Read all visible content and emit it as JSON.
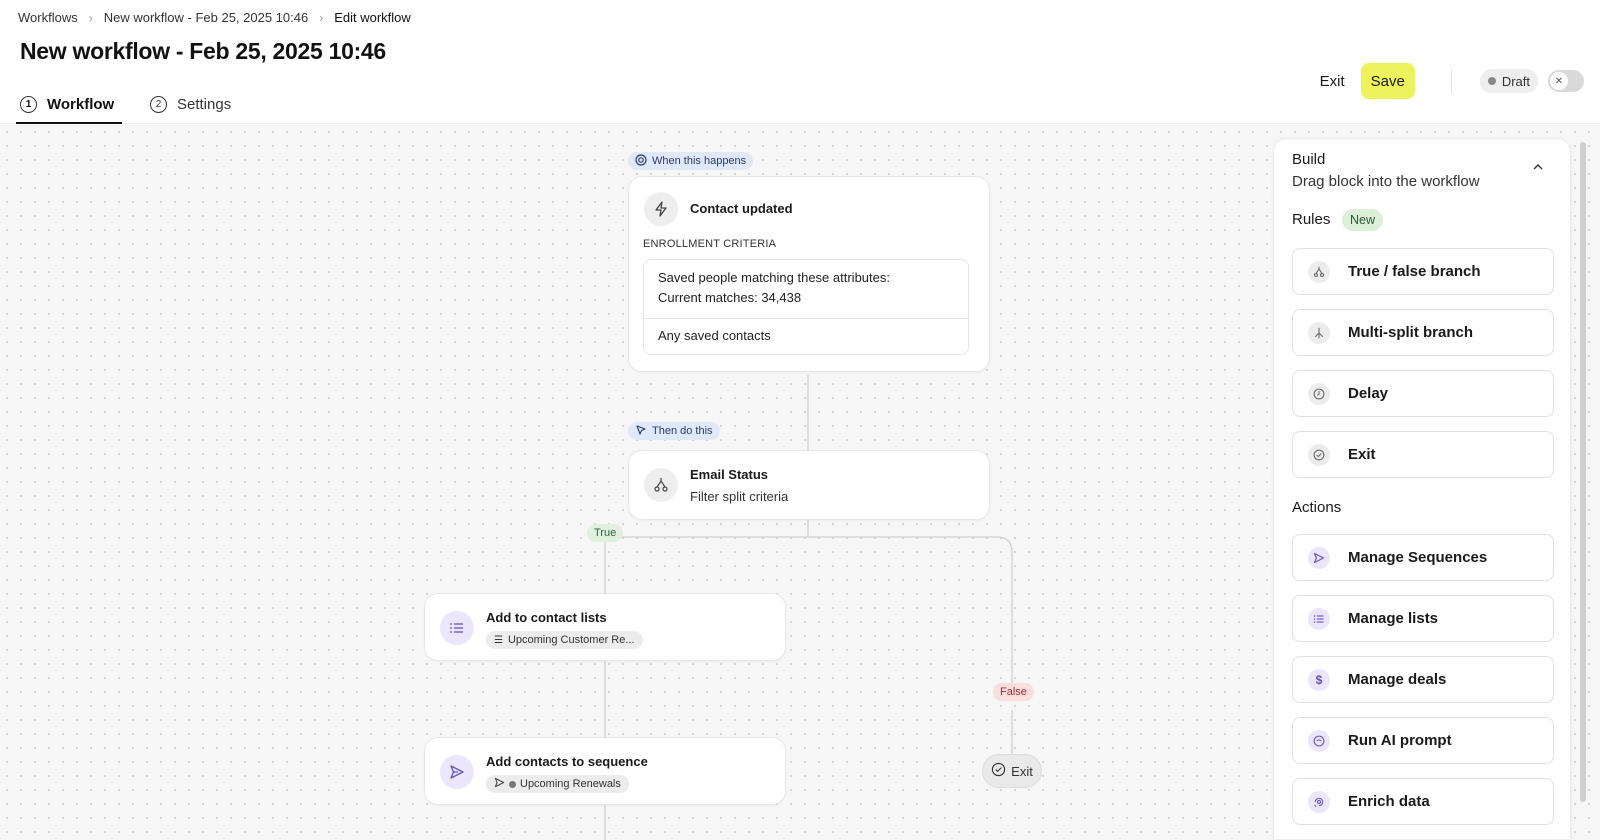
{
  "breadcrumb": {
    "root": "Workflows",
    "workflow": "New workflow - Feb 25, 2025 10:46",
    "current": "Edit workflow"
  },
  "page_title": "New workflow - Feb 25, 2025 10:46",
  "tabs": [
    {
      "num": "1",
      "label": "Workflow",
      "active": true
    },
    {
      "num": "2",
      "label": "Settings",
      "active": false
    }
  ],
  "actions": {
    "exit": "Exit",
    "save": "Save",
    "status": "Draft"
  },
  "colors": {
    "save_accent": "#ecf35c",
    "true_badge": "#dff0de",
    "false_badge": "#fadede",
    "trigger_badge": "#dfe9fb",
    "action_icon": "#ebe6fb"
  },
  "canvas": {
    "trigger_label": "When this happens",
    "trigger": {
      "title": "Contact updated",
      "criteria_label": "ENROLLMENT CRITERIA",
      "criteria_line1": "Saved people matching these attributes:",
      "criteria_line2": "Current matches: 34,438",
      "criteria_line3": "Any saved contacts"
    },
    "then_label": "Then do this",
    "split": {
      "title": "Email Status",
      "subtitle": "Filter split criteria"
    },
    "true_label": "True",
    "false_label": "False",
    "list_action": {
      "title": "Add to contact lists",
      "chip": "Upcoming Customer Re..."
    },
    "sequence_action": {
      "title": "Add contacts to sequence",
      "chip": "Upcoming Renewals"
    },
    "exit_node": "Exit"
  },
  "sidebar": {
    "title": "Build",
    "subtitle": "Drag block into the workflow",
    "rules_heading": "Rules",
    "new_badge": "New",
    "rules": [
      {
        "label": "True / false branch",
        "icon": "branch-icon"
      },
      {
        "label": "Multi-split branch",
        "icon": "multi-split-icon"
      },
      {
        "label": "Delay",
        "icon": "clock-icon"
      },
      {
        "label": "Exit",
        "icon": "check-circle-icon"
      }
    ],
    "actions_heading": "Actions",
    "actions": [
      {
        "label": "Manage Sequences",
        "icon": "send-icon"
      },
      {
        "label": "Manage lists",
        "icon": "list-icon"
      },
      {
        "label": "Manage deals",
        "icon": "dollar-icon"
      },
      {
        "label": "Run AI prompt",
        "icon": "ai-icon"
      },
      {
        "label": "Enrich data",
        "icon": "enrich-icon"
      }
    ]
  }
}
